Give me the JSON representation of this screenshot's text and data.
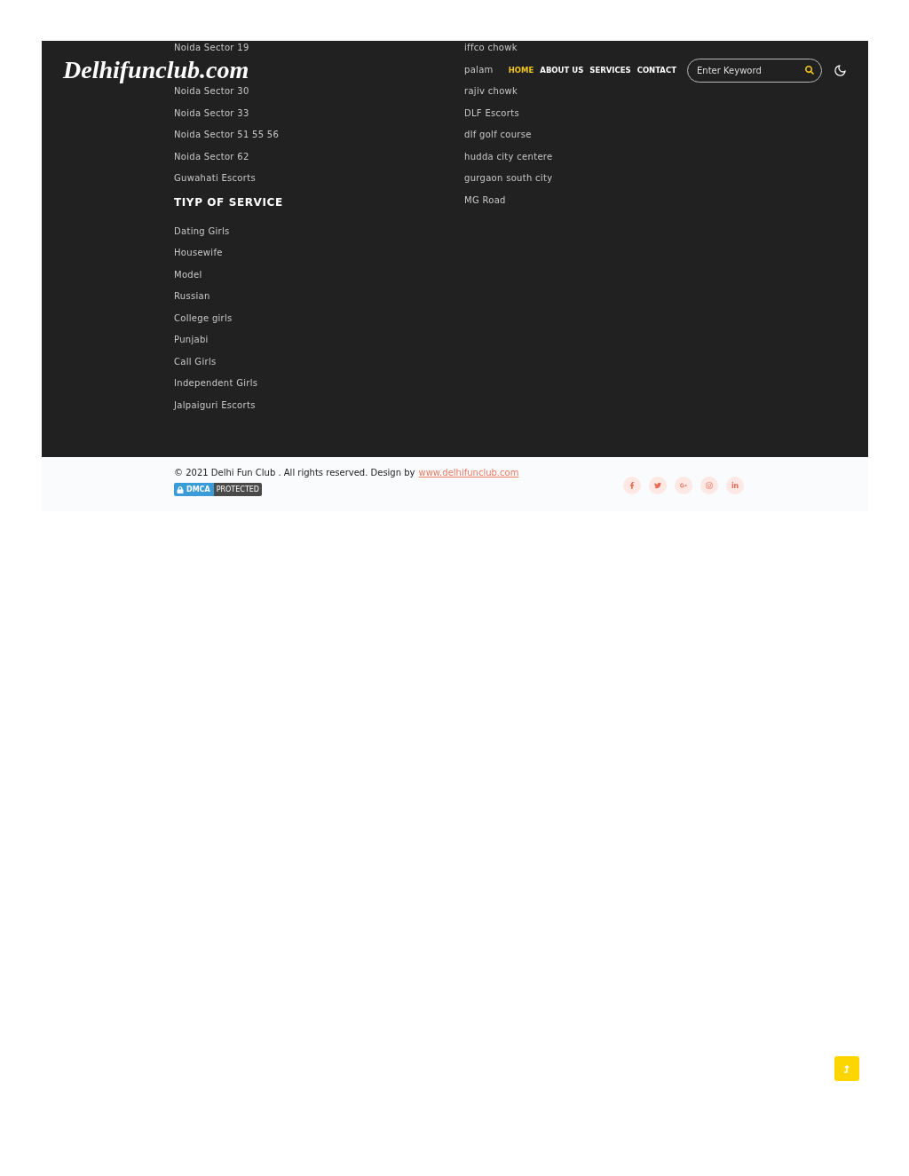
{
  "header": {
    "logo": "Delhifunclub.com",
    "nav": [
      {
        "label": "HOME",
        "selected": true
      },
      {
        "label": "ABOUT US",
        "selected": false
      },
      {
        "label": "SERVICES",
        "selected": false
      },
      {
        "label": "CONTACT",
        "selected": false
      }
    ],
    "search": {
      "placeholder": "Enter Keyword"
    }
  },
  "footer_links": {
    "left_top": [
      "Noida Sector 19"
    ],
    "left": [
      "Noida Sector 30",
      "Noida Sector 33",
      "Noida Sector 51 55 56",
      "Noida Sector 62",
      "Guwahati Escorts"
    ],
    "service_heading": "TIYP OF SERVICE",
    "services": [
      "Dating Girls",
      "Housewife",
      "Model",
      "Russian",
      "College girls",
      "Punjabi",
      "Call Girls",
      "Independent Girls",
      "Jalpaiguri Escorts"
    ],
    "right_top": [
      "iffco chowk",
      "palam"
    ],
    "right": [
      "rajiv chowk",
      "DLF Escorts",
      "dlf golf course",
      "hudda city centere",
      "gurgaon south city",
      "MG Road"
    ]
  },
  "bottom_bar": {
    "copyright": "© 2021 Delhi Fun Club . All rights reserved. Design by",
    "link": "www.delhifunclub.com",
    "dmca": [
      "DMCA",
      "PROTECTED"
    ]
  }
}
